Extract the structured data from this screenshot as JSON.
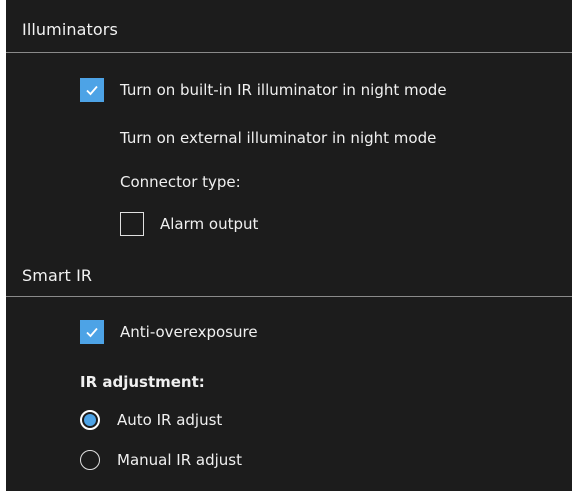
{
  "illuminators": {
    "header": "Illuminators",
    "builtin_ir_label": "Turn on built-in IR illuminator in night mode",
    "builtin_ir_checked": true,
    "external_label": "Turn on external illuminator in night mode",
    "connector_type_label": "Connector type:",
    "alarm_output_label": "Alarm output",
    "alarm_output_checked": false
  },
  "smart_ir": {
    "header": "Smart IR",
    "anti_overexposure_label": "Anti-overexposure",
    "anti_overexposure_checked": true,
    "ir_adjustment_label": "IR adjustment:",
    "options": [
      {
        "label": "Auto IR adjust",
        "selected": true
      },
      {
        "label": "Manual IR adjust",
        "selected": false
      }
    ]
  },
  "colors": {
    "background": "#1c1c1c",
    "accent": "#4da3e6",
    "divider": "#8a8a8a"
  },
  "icons": {
    "check": "checkmark-icon"
  }
}
